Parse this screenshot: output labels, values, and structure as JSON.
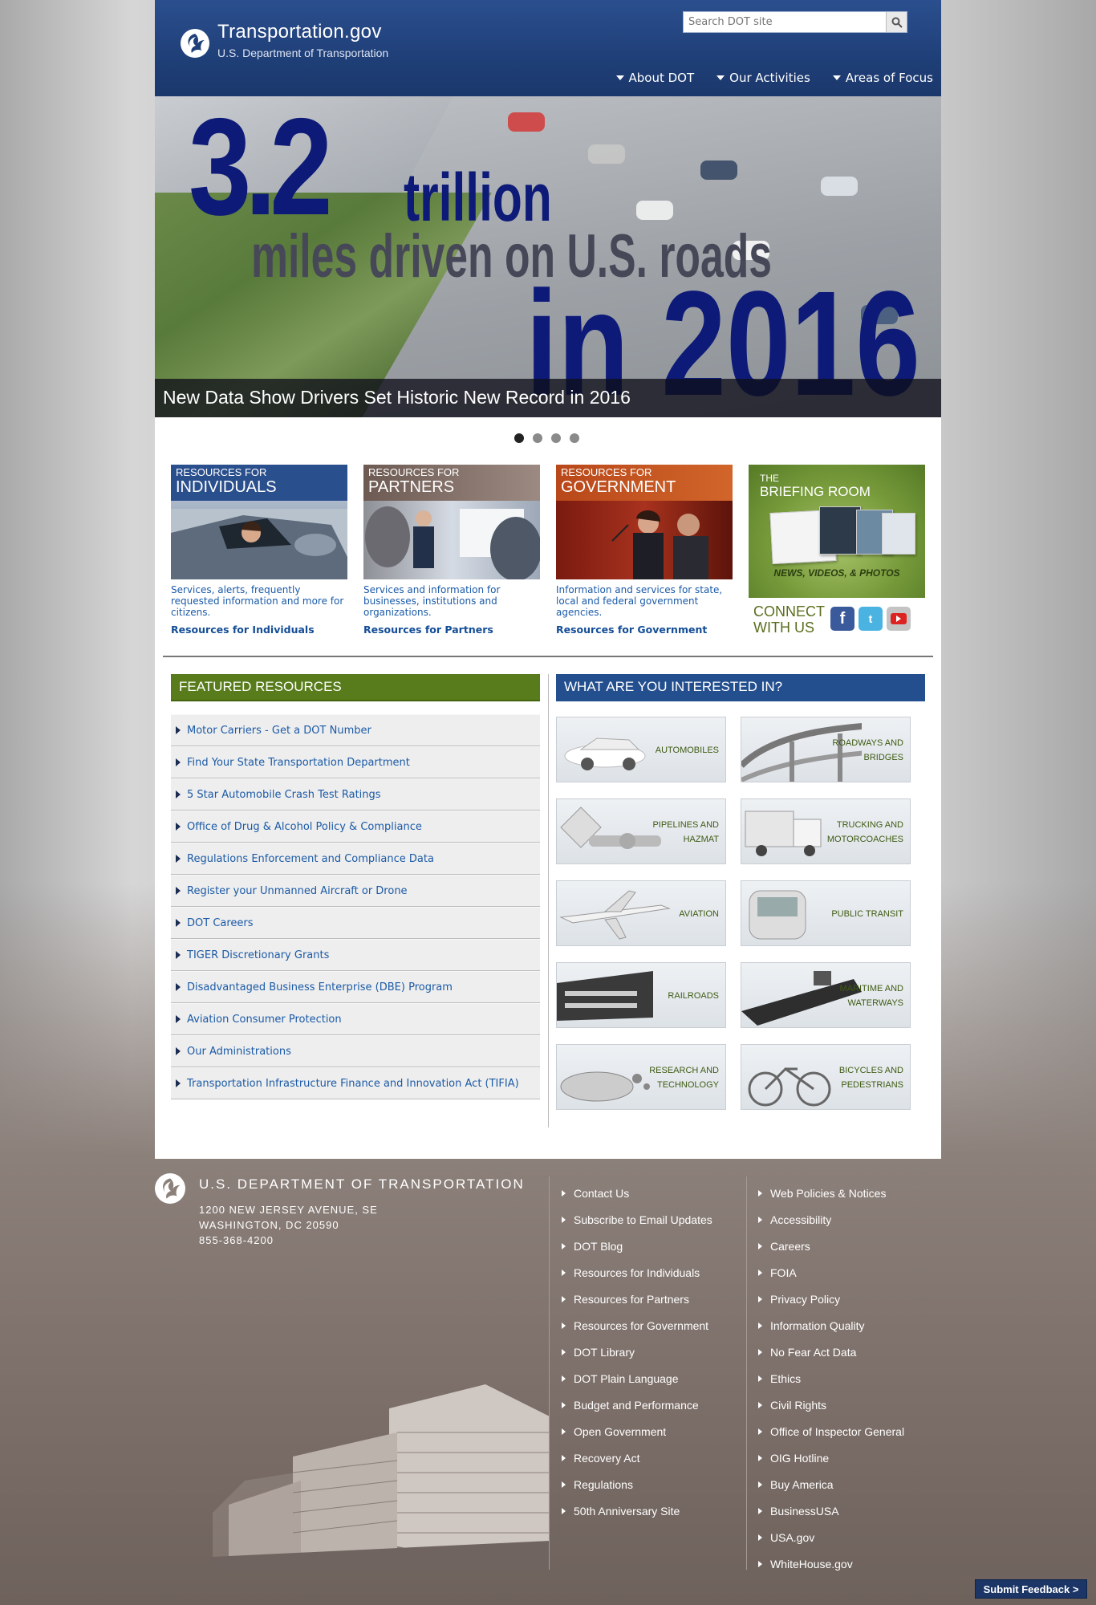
{
  "header": {
    "site_title": "Transportation.gov",
    "site_subtitle": "U.S. Department of Transportation",
    "search_placeholder": "Search DOT site",
    "nav": [
      "About DOT",
      "Our Activities",
      "Areas of Focus"
    ]
  },
  "hero": {
    "line1": "3.2",
    "line1b": "trillion",
    "line2": "miles driven on U.S. roads",
    "line3": "in 2016",
    "caption": "New Data Show Drivers Set Historic New Record in 2016",
    "slides_total": 4,
    "active_slide": 1
  },
  "resources": [
    {
      "kicker": "RESOURCES FOR",
      "title": "INDIVIDUALS",
      "desc": "Services, alerts, frequently requested information and more for citizens.",
      "link": "Resources for Individuals",
      "color": "#2a4f8d"
    },
    {
      "kicker": "RESOURCES FOR",
      "title": "PARTNERS",
      "desc": "Services and information for businesses, institutions and organizations.",
      "link": "Resources for Partners",
      "color": "#7d6a62"
    },
    {
      "kicker": "RESOURCES FOR",
      "title": "GOVERNMENT",
      "desc": "Information and services for state, local and federal government agencies.",
      "link": "Resources for Government",
      "color": "#b9481a"
    }
  ],
  "briefing": {
    "kicker": "THE",
    "title": "BRIEFING ROOM",
    "tag": "NEWS, VIDEOS, & PHOTOS"
  },
  "connect": {
    "line1": "CONNECT",
    "line2": "WITH US",
    "icons": [
      "facebook-icon",
      "twitter-icon",
      "youtube-icon"
    ]
  },
  "featured": {
    "title": "FEATURED RESOURCES",
    "items": [
      "Motor Carriers - Get a DOT Number",
      "Find Your State Transportation Department",
      "5 Star Automobile Crash Test Ratings",
      "Office of Drug & Alcohol Policy & Compliance",
      "Regulations Enforcement and Compliance Data",
      "Register your Unmanned Aircraft or Drone",
      "DOT Careers",
      "TIGER Discretionary Grants",
      "Disadvantaged Business Enterprise (DBE) Program",
      "Aviation Consumer Protection",
      "Our Administrations",
      "Transportation Infrastructure Finance and Innovation Act (TIFIA)"
    ]
  },
  "interests": {
    "title": "WHAT ARE YOU INTERESTED IN?",
    "tiles": [
      {
        "line1": "AUTOMOBILES",
        "line2": ""
      },
      {
        "line1": "ROADWAYS AND",
        "line2": "BRIDGES"
      },
      {
        "line1": "PIPELINES AND",
        "line2": "HAZMAT"
      },
      {
        "line1": "TRUCKING AND",
        "line2": "MOTORCOACHES"
      },
      {
        "line1": "AVIATION",
        "line2": ""
      },
      {
        "line1": "PUBLIC TRANSIT",
        "line2": ""
      },
      {
        "line1": "RAILROADS",
        "line2": ""
      },
      {
        "line1": "MARITIME AND",
        "line2": "WATERWAYS"
      },
      {
        "line1": "RESEARCH AND",
        "line2": "TECHNOLOGY"
      },
      {
        "line1": "BICYCLES AND",
        "line2": "PEDESTRIANS"
      }
    ]
  },
  "footer": {
    "org": "U.S. DEPARTMENT OF TRANSPORTATION",
    "address1": "1200 NEW JERSEY AVENUE, SE",
    "address2": "WASHINGTON, DC 20590",
    "phone": "855-368-4200",
    "col1": [
      "Contact Us",
      "Subscribe to Email Updates",
      "DOT Blog",
      "Resources for Individuals",
      "Resources for Partners",
      "Resources for Government",
      "DOT Library",
      "DOT Plain Language",
      "Budget and Performance",
      "Open Government",
      "Recovery Act",
      "Regulations",
      "50th Anniversary Site"
    ],
    "col2": [
      "Web Policies & Notices",
      "Accessibility",
      "Careers",
      "FOIA",
      "Privacy Policy",
      "Information Quality",
      "No Fear Act Data",
      "Ethics",
      "Civil Rights",
      "Office of Inspector General",
      "OIG Hotline",
      "Buy America",
      "BusinessUSA",
      "USA.gov",
      "WhiteHouse.gov"
    ],
    "feedback": "Submit Feedback >"
  }
}
